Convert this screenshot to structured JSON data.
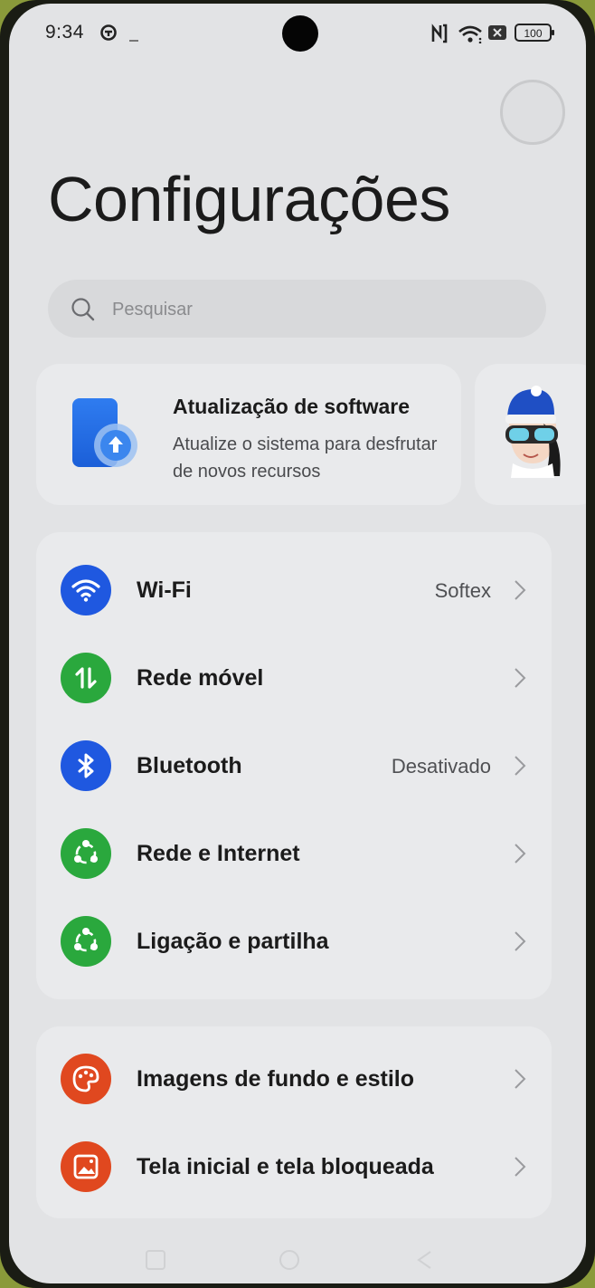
{
  "status_bar": {
    "time": "9:34",
    "battery": "100"
  },
  "page": {
    "title": "Configurações"
  },
  "search": {
    "placeholder": "Pesquisar"
  },
  "update_card": {
    "title": "Atualização de software",
    "description": "Atualize o sistema para desfrutar de novos recursos"
  },
  "groups": [
    {
      "items": [
        {
          "label": "Wi-Fi",
          "value": "Softex",
          "icon": "wifi-icon",
          "color": "#1f58e0"
        },
        {
          "label": "Rede móvel",
          "value": "",
          "icon": "mobile-data-icon",
          "color": "#2aa83d"
        },
        {
          "label": "Bluetooth",
          "value": "Desativado",
          "icon": "bluetooth-icon",
          "color": "#1f58e0"
        },
        {
          "label": "Rede e Internet",
          "value": "",
          "icon": "network-icon",
          "color": "#2aa83d"
        },
        {
          "label": "Ligação e partilha",
          "value": "",
          "icon": "share-icon",
          "color": "#2aa83d"
        }
      ]
    },
    {
      "items": [
        {
          "label": "Imagens de fundo e estilo",
          "value": "",
          "icon": "palette-icon",
          "color": "#e0481f"
        },
        {
          "label": "Tela inicial e tela bloqueada",
          "value": "",
          "icon": "image-icon",
          "color": "#e0481f"
        }
      ]
    }
  ]
}
